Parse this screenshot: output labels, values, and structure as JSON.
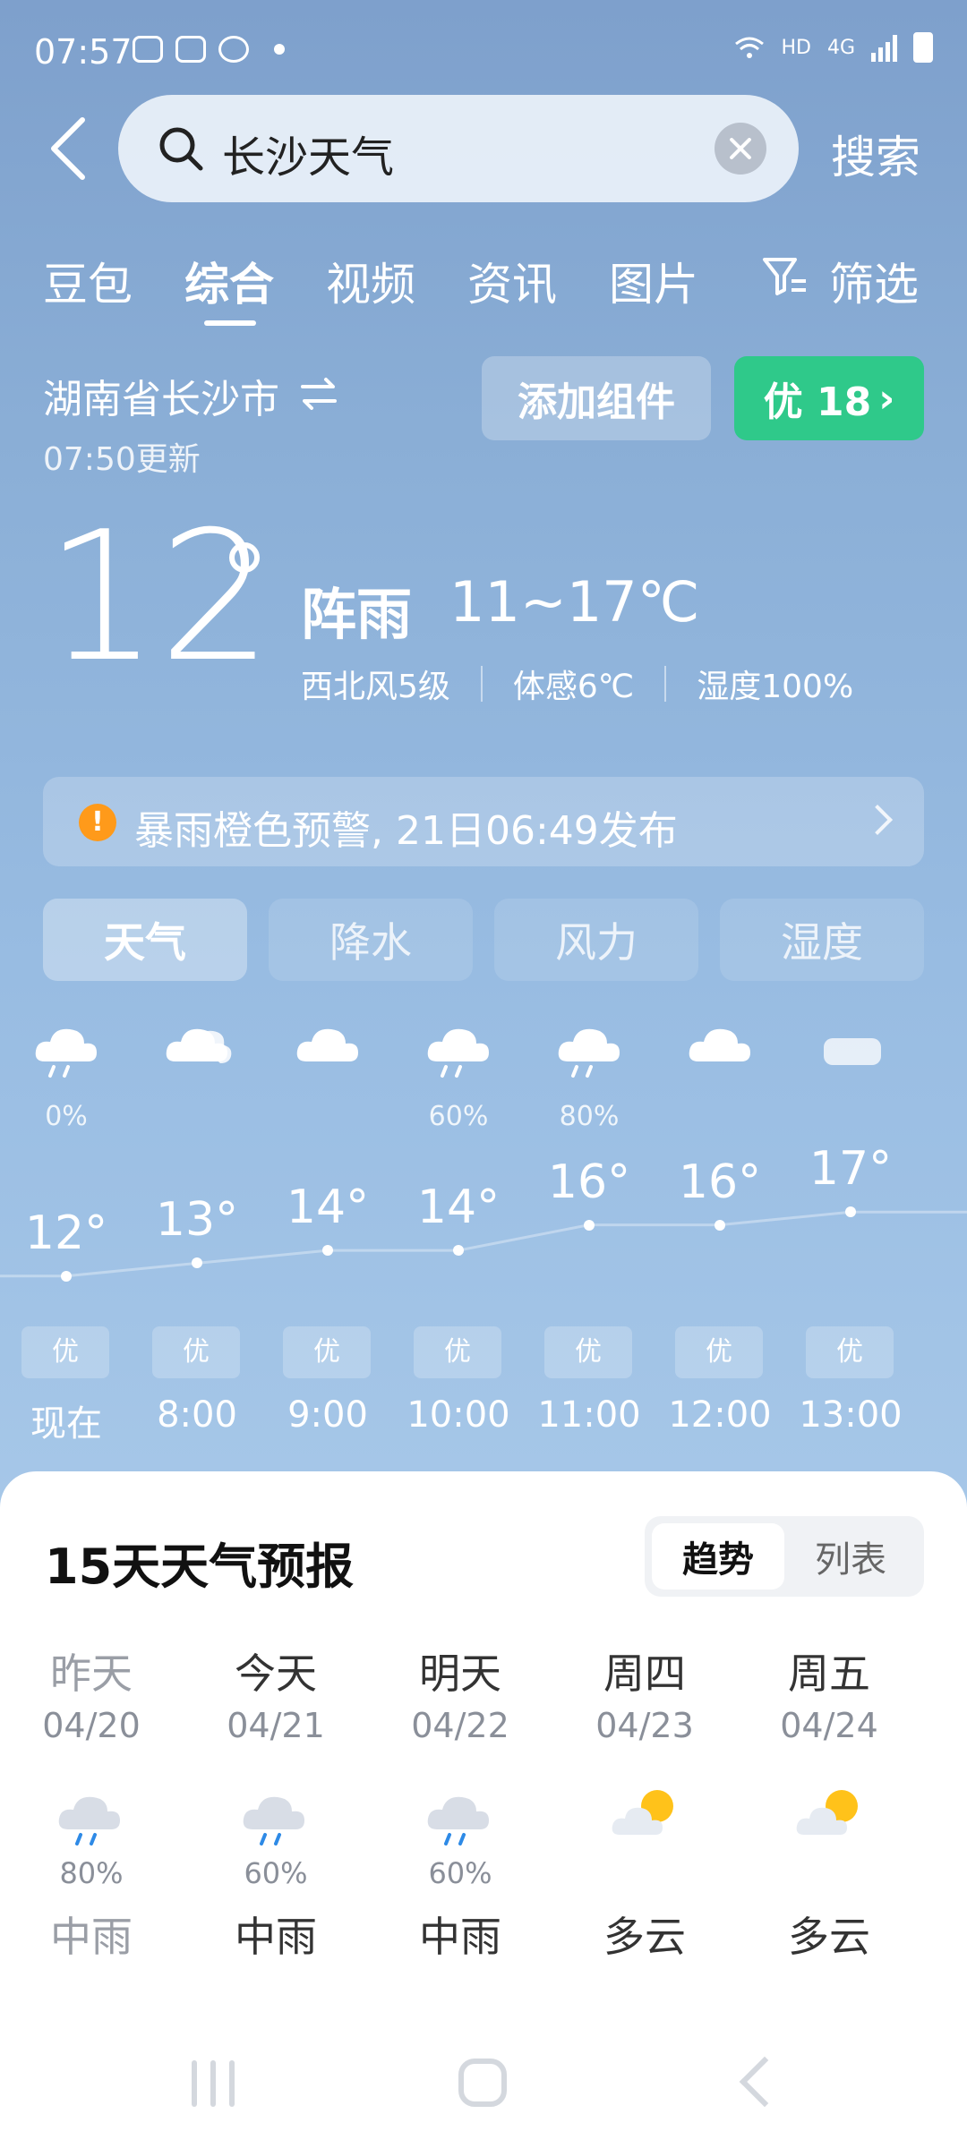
{
  "status_bar": {
    "time": "07:57",
    "network": "HD",
    "network2": "4G"
  },
  "search": {
    "query": "长沙天气",
    "submit_label": "搜索"
  },
  "tabs": [
    {
      "label": "豆包",
      "active": false
    },
    {
      "label": "综合",
      "active": true
    },
    {
      "label": "视频",
      "active": false
    },
    {
      "label": "资讯",
      "active": false
    },
    {
      "label": "图片",
      "active": false
    },
    {
      "label": "筛选",
      "active": false
    }
  ],
  "location": {
    "name": "湖南省长沙市",
    "updated": "07:50更新"
  },
  "actions": {
    "add_widget": "添加组件",
    "aqi": "优 18"
  },
  "current": {
    "temp": "12",
    "condition": "阵雨",
    "range": "11~17℃",
    "wind": "西北风5级",
    "feels_like": "体感6℃",
    "humidity": "湿度100%"
  },
  "warning": {
    "text": "暴雨橙色预警, 21日06:49发布"
  },
  "segments": [
    {
      "label": "天气",
      "active": true
    },
    {
      "label": "降水",
      "active": false
    },
    {
      "label": "风力",
      "active": false
    },
    {
      "label": "湿度",
      "active": false
    }
  ],
  "hourly": [
    {
      "time": "现在",
      "temp": "12°",
      "temp_value": 12,
      "precip": "0%",
      "icon": "cloud-rain-icon",
      "aqi": "优"
    },
    {
      "time": "8:00",
      "temp": "13°",
      "temp_value": 13,
      "precip": "",
      "icon": "cloudy-icon",
      "aqi": "优"
    },
    {
      "time": "9:00",
      "temp": "14°",
      "temp_value": 14,
      "precip": "",
      "icon": "cloud-icon",
      "aqi": "优"
    },
    {
      "time": "10:00",
      "temp": "14°",
      "temp_value": 14,
      "precip": "60%",
      "icon": "cloud-rain-icon",
      "aqi": "优"
    },
    {
      "time": "11:00",
      "temp": "16°",
      "temp_value": 16,
      "precip": "80%",
      "icon": "cloud-rain-icon",
      "aqi": "优"
    },
    {
      "time": "12:00",
      "temp": "16°",
      "temp_value": 16,
      "precip": "",
      "icon": "cloud-icon",
      "aqi": "优"
    },
    {
      "time": "13:00",
      "temp": "17°",
      "temp_value": 17,
      "precip": "",
      "icon": "haze-icon",
      "aqi": "优"
    }
  ],
  "forecast": {
    "title": "15天天气预报",
    "toggle_trend": "趋势",
    "toggle_list": "列表",
    "days": [
      {
        "label": "昨天",
        "date": "04/20",
        "precip": "80%",
        "condition": "中雨",
        "icon": "rain-icon",
        "past": true
      },
      {
        "label": "今天",
        "date": "04/21",
        "precip": "60%",
        "condition": "中雨",
        "icon": "rain-icon",
        "past": false
      },
      {
        "label": "明天",
        "date": "04/22",
        "precip": "60%",
        "condition": "中雨",
        "icon": "rain-icon",
        "past": false
      },
      {
        "label": "周四",
        "date": "04/23",
        "precip": "",
        "condition": "多云",
        "icon": "partly-cloudy-icon",
        "past": false
      },
      {
        "label": "周五",
        "date": "04/24",
        "precip": "",
        "condition": "多云",
        "icon": "partly-cloudy-icon",
        "past": false
      }
    ]
  },
  "colors": {
    "aqi_green": "#2fc98a",
    "warning_orange": "#ff9a1a",
    "sky_top": "#7ea0cc",
    "sky_bottom": "#b0cdea"
  }
}
